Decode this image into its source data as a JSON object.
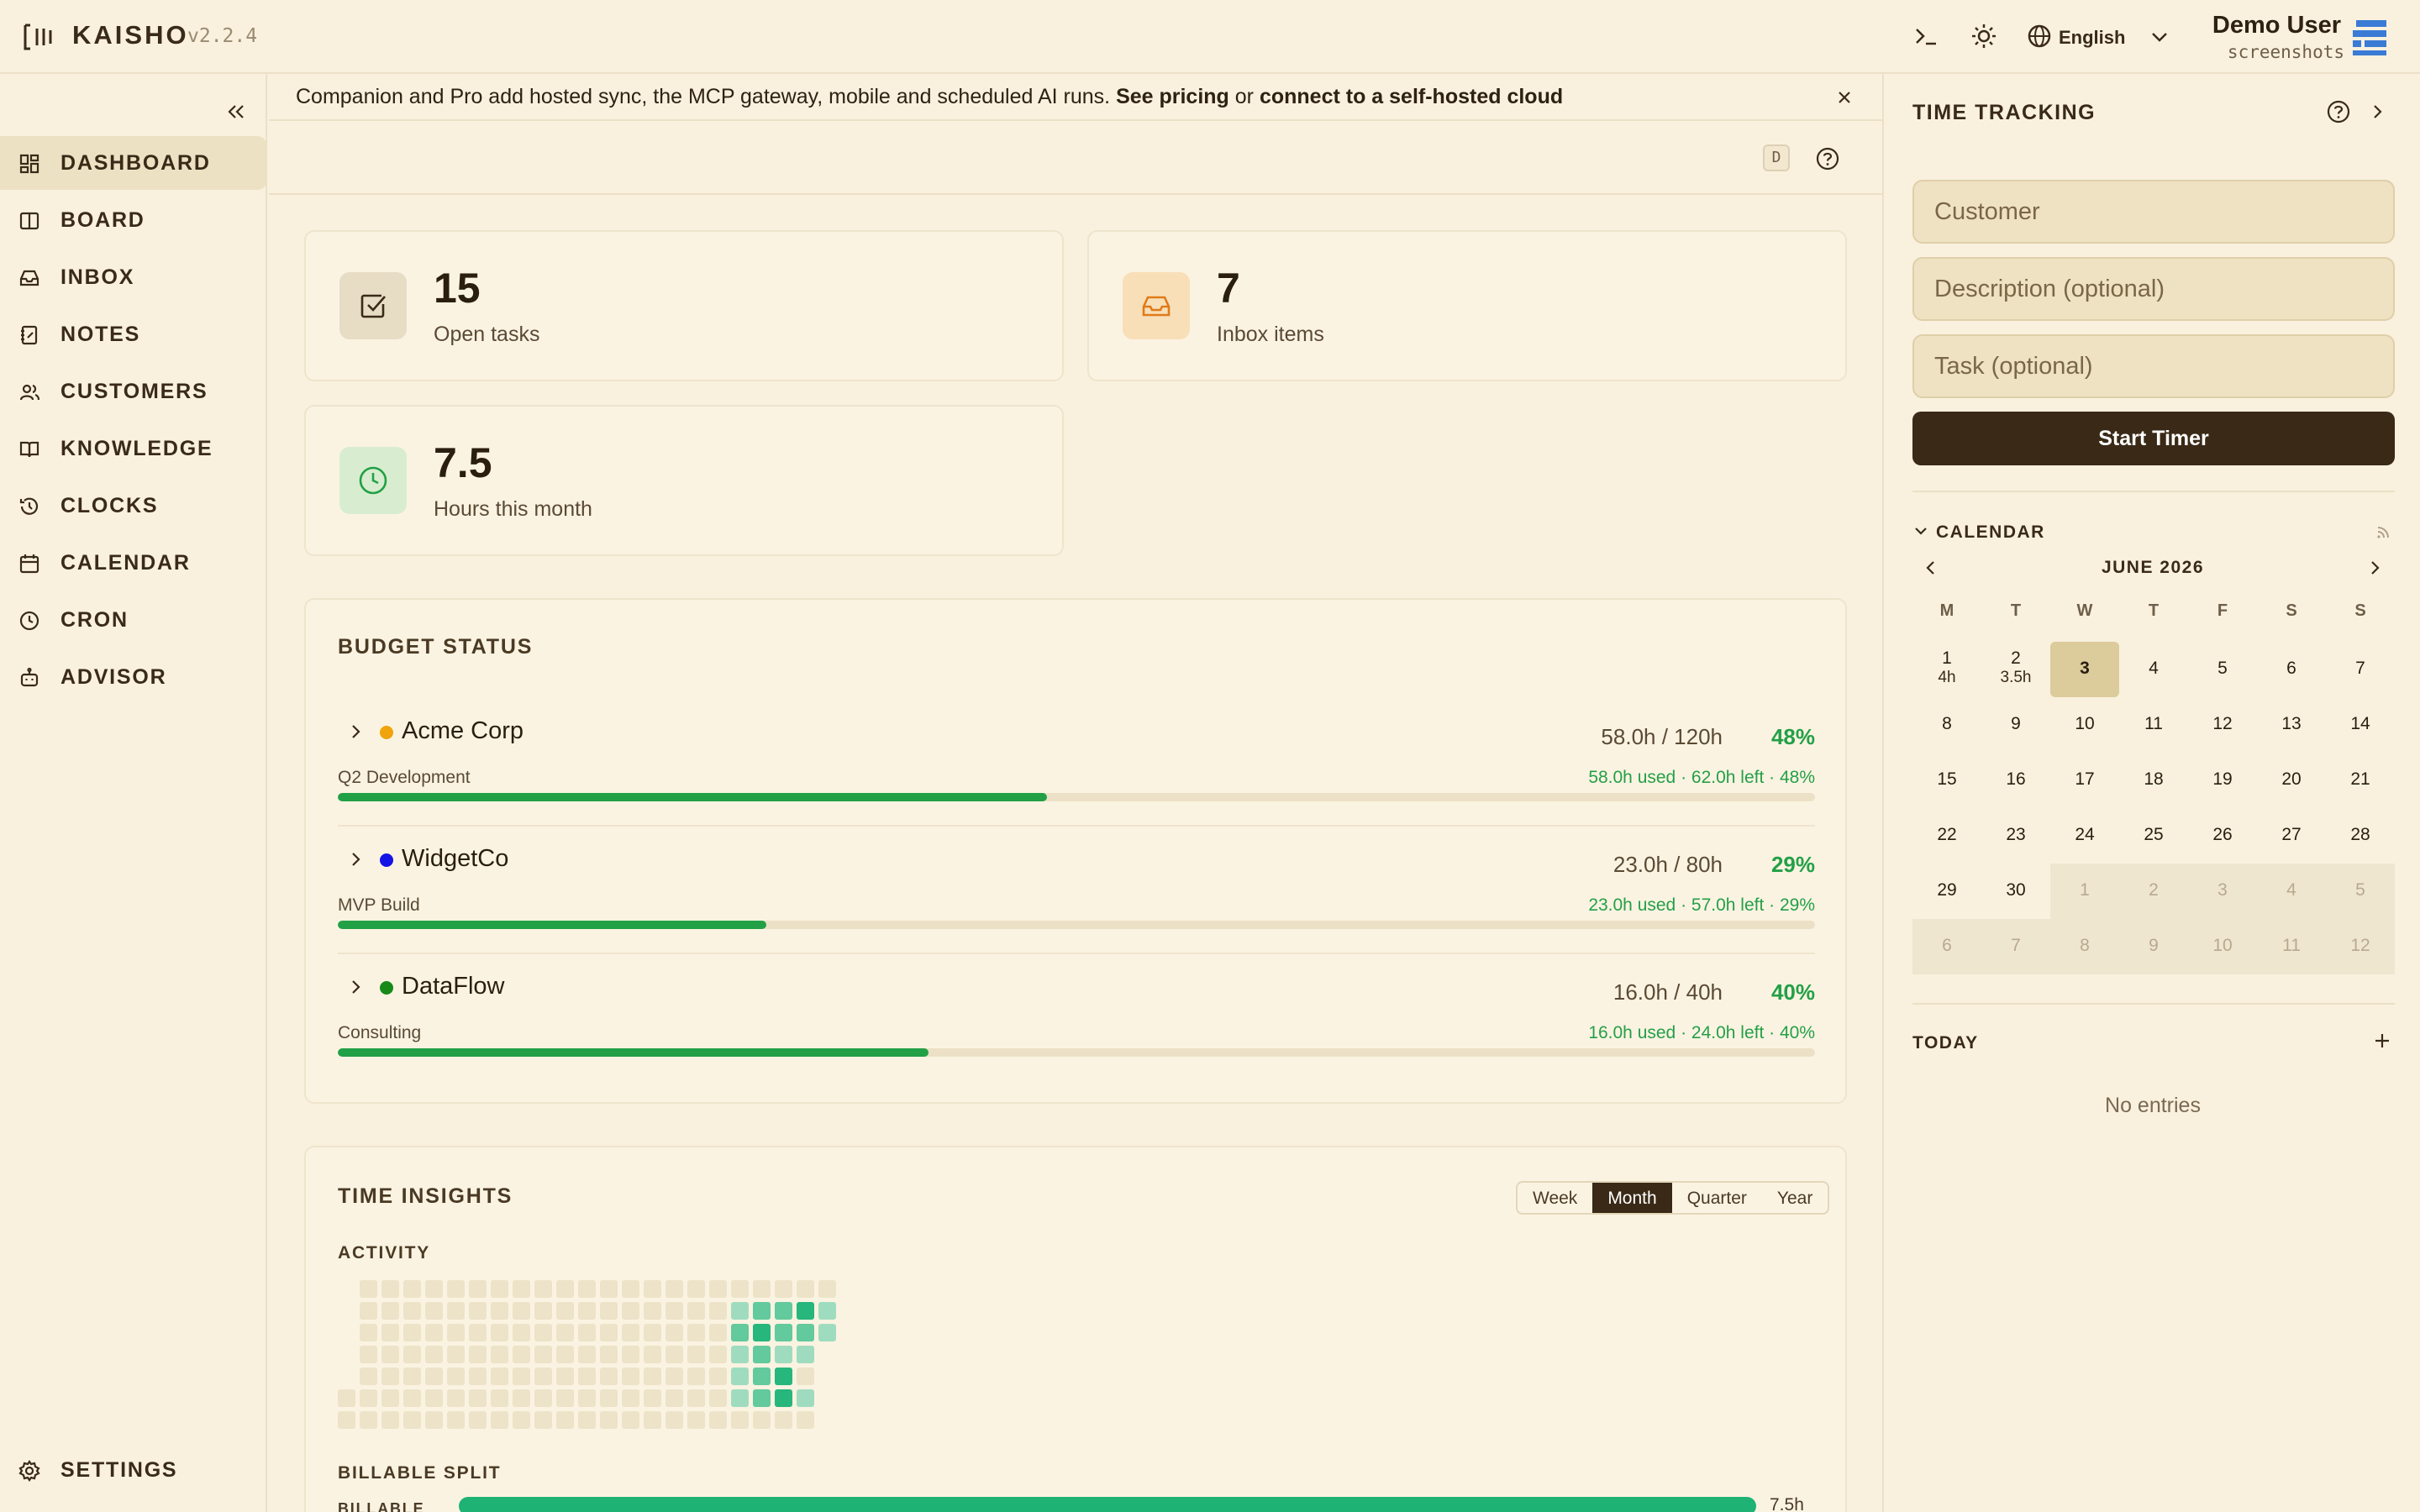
{
  "app": {
    "name": "KAISHO",
    "version": "v2.2.4"
  },
  "header": {
    "language": "English",
    "user_name": "Demo User",
    "user_sub": "screenshots"
  },
  "sidebar": {
    "items": [
      {
        "label": "DASHBOARD",
        "icon": "dashboard-icon",
        "active": true
      },
      {
        "label": "BOARD",
        "icon": "board-icon"
      },
      {
        "label": "INBOX",
        "icon": "inbox-icon"
      },
      {
        "label": "NOTES",
        "icon": "notes-icon"
      },
      {
        "label": "CUSTOMERS",
        "icon": "customers-icon"
      },
      {
        "label": "KNOWLEDGE",
        "icon": "book-icon"
      },
      {
        "label": "CLOCKS",
        "icon": "history-clock-icon"
      },
      {
        "label": "CALENDAR",
        "icon": "calendar-icon"
      },
      {
        "label": "CRON",
        "icon": "clock-icon"
      },
      {
        "label": "ADVISOR",
        "icon": "bot-icon"
      }
    ],
    "settings_label": "SETTINGS"
  },
  "banner": {
    "text": "Companion and Pro add hosted sync, the MCP gateway, mobile and scheduled AI runs.",
    "link1": "See pricing",
    "or": "or",
    "link2": "connect to a self-hosted cloud"
  },
  "toolbar": {
    "shortcut_key": "D"
  },
  "stats": [
    {
      "value": "15",
      "caption": "Open tasks",
      "icon": "checkbox-icon"
    },
    {
      "value": "7",
      "caption": "Inbox items",
      "icon": "inbox-icon"
    },
    {
      "value": "7.5",
      "caption": "Hours this month",
      "icon": "clock-icon"
    }
  ],
  "budget": {
    "title": "BUDGET STATUS",
    "rows": [
      {
        "name": "Acme Corp",
        "color": "#f0a30a",
        "hours": "58.0h / 120h",
        "pct": "48%",
        "project": "Q2 Development",
        "detail": "58.0h used · 62.0h left · 48%",
        "fraction": 0.48
      },
      {
        "name": "WidgetCo",
        "color": "#1414e6",
        "hours": "23.0h / 80h",
        "pct": "29%",
        "project": "MVP Build",
        "detail": "23.0h used · 57.0h left · 29%",
        "fraction": 0.29
      },
      {
        "name": "DataFlow",
        "color": "#178a17",
        "hours": "16.0h / 40h",
        "pct": "40%",
        "project": "Consulting",
        "detail": "16.0h used · 24.0h left · 40%",
        "fraction": 0.4
      }
    ]
  },
  "insights": {
    "title": "TIME INSIGHTS",
    "ranges": [
      "Week",
      "Month",
      "Quarter",
      "Year"
    ],
    "selected_range": "Month",
    "activity_label": "ACTIVITY",
    "billable_split_label": "BILLABLE SPLIT",
    "billable_label": "BILLABLE",
    "billable_value": "7.5h"
  },
  "time_tracking": {
    "title": "TIME TRACKING",
    "customer_placeholder": "Customer",
    "description_placeholder": "Description (optional)",
    "task_placeholder": "Task (optional)",
    "start_label": "Start Timer"
  },
  "calendar": {
    "title": "CALENDAR",
    "month_label": "JUNE 2026",
    "weekdays": [
      "M",
      "T",
      "W",
      "T",
      "F",
      "S",
      "S"
    ],
    "weeks": [
      [
        {
          "d": "1",
          "h": "4h"
        },
        {
          "d": "2",
          "h": "3.5h"
        },
        {
          "d": "3",
          "today": true
        },
        {
          "d": "4"
        },
        {
          "d": "5"
        },
        {
          "d": "6"
        },
        {
          "d": "7"
        }
      ],
      [
        {
          "d": "8"
        },
        {
          "d": "9"
        },
        {
          "d": "10"
        },
        {
          "d": "11"
        },
        {
          "d": "12"
        },
        {
          "d": "13"
        },
        {
          "d": "14"
        }
      ],
      [
        {
          "d": "15"
        },
        {
          "d": "16"
        },
        {
          "d": "17"
        },
        {
          "d": "18"
        },
        {
          "d": "19"
        },
        {
          "d": "20"
        },
        {
          "d": "21"
        }
      ],
      [
        {
          "d": "22"
        },
        {
          "d": "23"
        },
        {
          "d": "24"
        },
        {
          "d": "25"
        },
        {
          "d": "26"
        },
        {
          "d": "27"
        },
        {
          "d": "28"
        }
      ],
      [
        {
          "d": "29"
        },
        {
          "d": "30"
        },
        {
          "d": "1",
          "other": true
        },
        {
          "d": "2",
          "other": true
        },
        {
          "d": "3",
          "other": true
        },
        {
          "d": "4",
          "other": true
        },
        {
          "d": "5",
          "other": true
        }
      ],
      [
        {
          "d": "6",
          "other": true
        },
        {
          "d": "7",
          "other": true
        },
        {
          "d": "8",
          "other": true
        },
        {
          "d": "9",
          "other": true
        },
        {
          "d": "10",
          "other": true
        },
        {
          "d": "11",
          "other": true
        },
        {
          "d": "12",
          "other": true
        }
      ]
    ]
  },
  "today": {
    "title": "TODAY",
    "empty_text": "No entries"
  },
  "activity_heatmap": {
    "colors": {
      "empty": "#ede3c8",
      "l1": "#9fdcbf",
      "l2": "#62ca9c",
      "l3": "#27b67c"
    },
    "columns": [
      {
        "start": 5,
        "levels": [
          0,
          0
        ]
      },
      {
        "start": 0,
        "levels": [
          0,
          0,
          0,
          0,
          0,
          0,
          0
        ]
      },
      {
        "start": 0,
        "levels": [
          0,
          0,
          0,
          0,
          0,
          0,
          0
        ]
      },
      {
        "start": 0,
        "levels": [
          0,
          0,
          0,
          0,
          0,
          0,
          0
        ]
      },
      {
        "start": 0,
        "levels": [
          0,
          0,
          0,
          0,
          0,
          0,
          0
        ]
      },
      {
        "start": 0,
        "levels": [
          0,
          0,
          0,
          0,
          0,
          0,
          0
        ]
      },
      {
        "start": 0,
        "levels": [
          0,
          0,
          0,
          0,
          0,
          0,
          0
        ]
      },
      {
        "start": 0,
        "levels": [
          0,
          0,
          0,
          0,
          0,
          0,
          0
        ]
      },
      {
        "start": 0,
        "levels": [
          0,
          0,
          0,
          0,
          0,
          0,
          0
        ]
      },
      {
        "start": 0,
        "levels": [
          0,
          0,
          0,
          0,
          0,
          0,
          0
        ]
      },
      {
        "start": 0,
        "levels": [
          0,
          0,
          0,
          0,
          0,
          0,
          0
        ]
      },
      {
        "start": 0,
        "levels": [
          0,
          0,
          0,
          0,
          0,
          0,
          0
        ]
      },
      {
        "start": 0,
        "levels": [
          0,
          0,
          0,
          0,
          0,
          0,
          0
        ]
      },
      {
        "start": 0,
        "levels": [
          0,
          0,
          0,
          0,
          0,
          0,
          0
        ]
      },
      {
        "start": 0,
        "levels": [
          0,
          0,
          0,
          0,
          0,
          0,
          0
        ]
      },
      {
        "start": 0,
        "levels": [
          0,
          0,
          0,
          0,
          0,
          0,
          0
        ]
      },
      {
        "start": 0,
        "levels": [
          0,
          0,
          0,
          0,
          0,
          0,
          0
        ]
      },
      {
        "start": 0,
        "levels": [
          0,
          0,
          0,
          0,
          0,
          0,
          0
        ]
      },
      {
        "start": 0,
        "levels": [
          0,
          1,
          2,
          1,
          1,
          1,
          0
        ]
      },
      {
        "start": 0,
        "levels": [
          0,
          2,
          3,
          2,
          2,
          2,
          0
        ]
      },
      {
        "start": 0,
        "levels": [
          0,
          2,
          2,
          1,
          3,
          3,
          0
        ]
      },
      {
        "start": 0,
        "levels": [
          0,
          3,
          2,
          1,
          0,
          1,
          0
        ]
      },
      {
        "start": 0,
        "levels": [
          0,
          1,
          1
        ]
      }
    ]
  }
}
